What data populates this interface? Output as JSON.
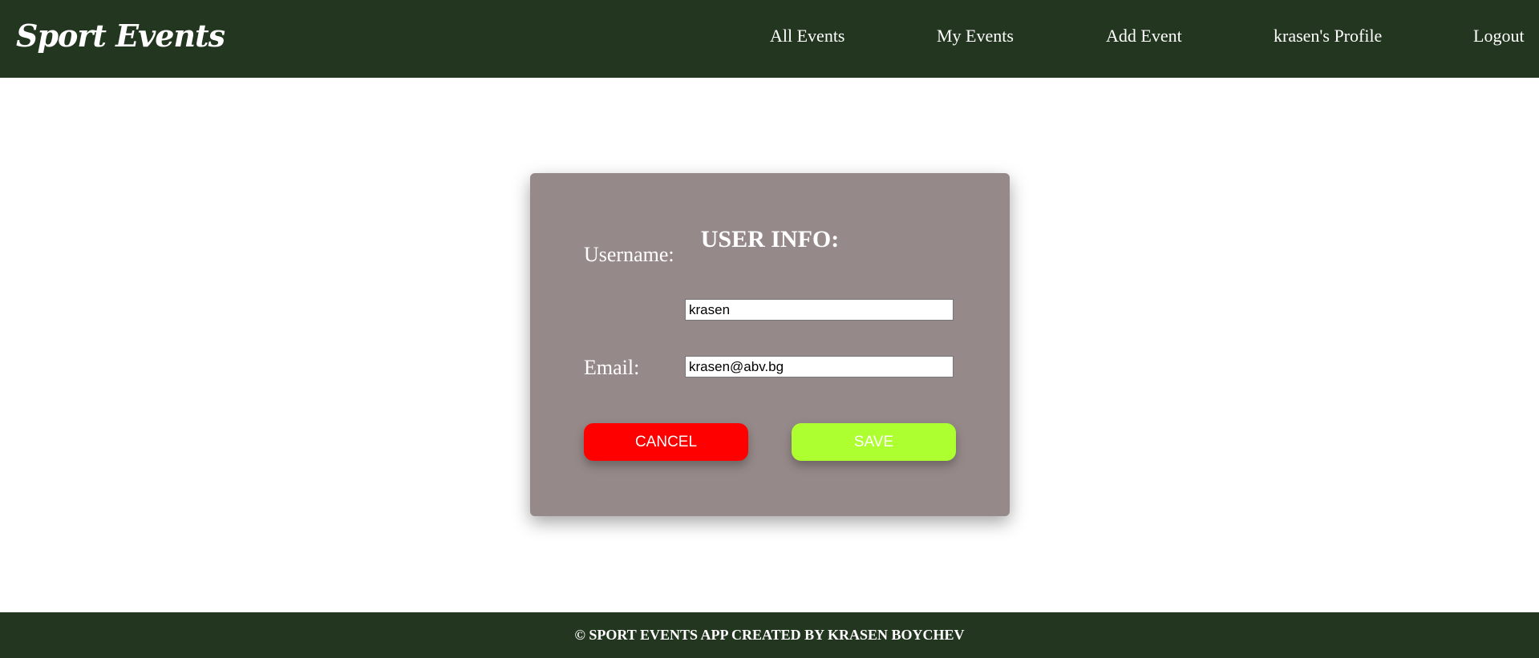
{
  "header": {
    "brand": "Sport Events",
    "nav": {
      "all_events": "All Events",
      "my_events": "My Events",
      "add_event": "Add Event",
      "profile": "krasen's Profile",
      "logout": "Logout"
    }
  },
  "user_info_card": {
    "title": "USER INFO:",
    "username_label": "Username:",
    "username_value": "krasen",
    "email_label": "Email:",
    "email_value": "krasen@abv.bg",
    "cancel_label": "CANCEL",
    "save_label": "SAVE"
  },
  "footer": {
    "text": "© SPORT EVENTS APP CREATED BY KRASEN BOYCHEV"
  },
  "colors": {
    "header_bg": "#233620",
    "card_bg": "#968989",
    "cancel_button": "#ff0000",
    "save_button": "#adff2f"
  }
}
